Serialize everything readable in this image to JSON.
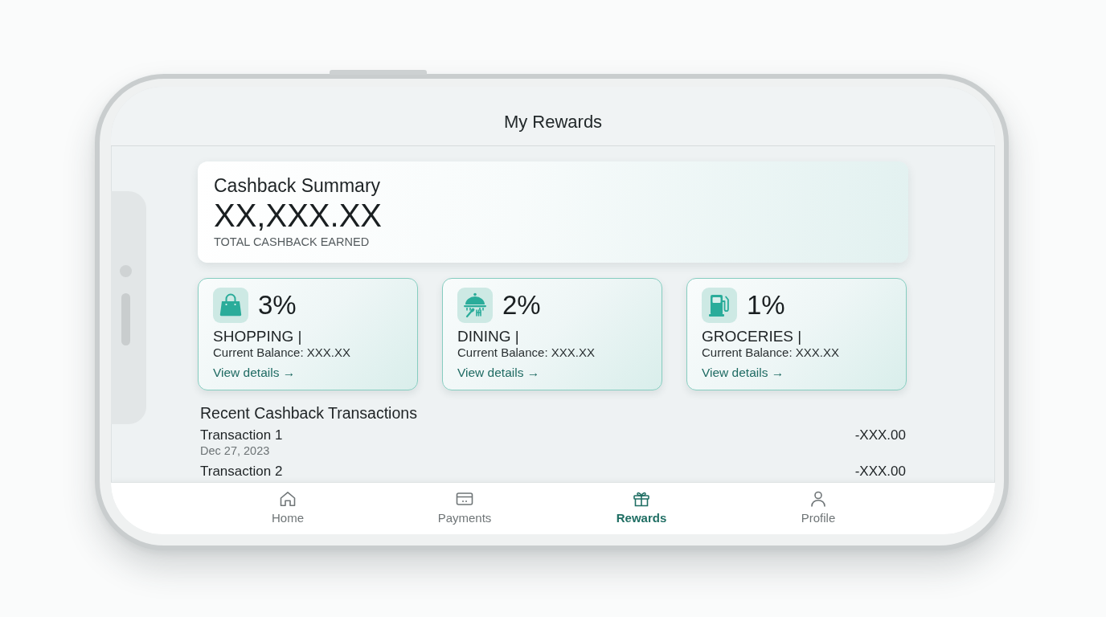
{
  "header": {
    "title": "My Rewards"
  },
  "summary": {
    "title": "Cashback Summary",
    "amount": "XX,XXX.XX",
    "caption": "TOTAL CASHBACK EARNED"
  },
  "categories": [
    {
      "kind": "shopping",
      "rate": "3%",
      "label": "SHOPPING |",
      "balance": "Current Balance: XXX.XX",
      "link": "View details →"
    },
    {
      "kind": "dining",
      "rate": "2%",
      "label": "DINING |",
      "balance": "Current Balance: XXX.XX",
      "link": "View details →"
    },
    {
      "kind": "fuel",
      "rate": "1%",
      "label": "GROCERIES |",
      "balance": "Current Balance: XXX.XX",
      "link": "View details →"
    }
  ],
  "transactions": {
    "title": "Recent Cashback Transactions",
    "rows": [
      {
        "name": "Transaction 1",
        "date": "Dec 27, 2023",
        "amount": "-XXX.00"
      },
      {
        "name": "Transaction 2",
        "amount": "-XXX.00"
      }
    ]
  },
  "nav": [
    {
      "kind": "home",
      "label": "Home",
      "selected": false
    },
    {
      "kind": "card",
      "label": "Payments",
      "selected": false
    },
    {
      "kind": "gift",
      "label": "Rewards",
      "selected": true
    },
    {
      "kind": "person",
      "label": "Profile",
      "selected": false
    }
  ]
}
